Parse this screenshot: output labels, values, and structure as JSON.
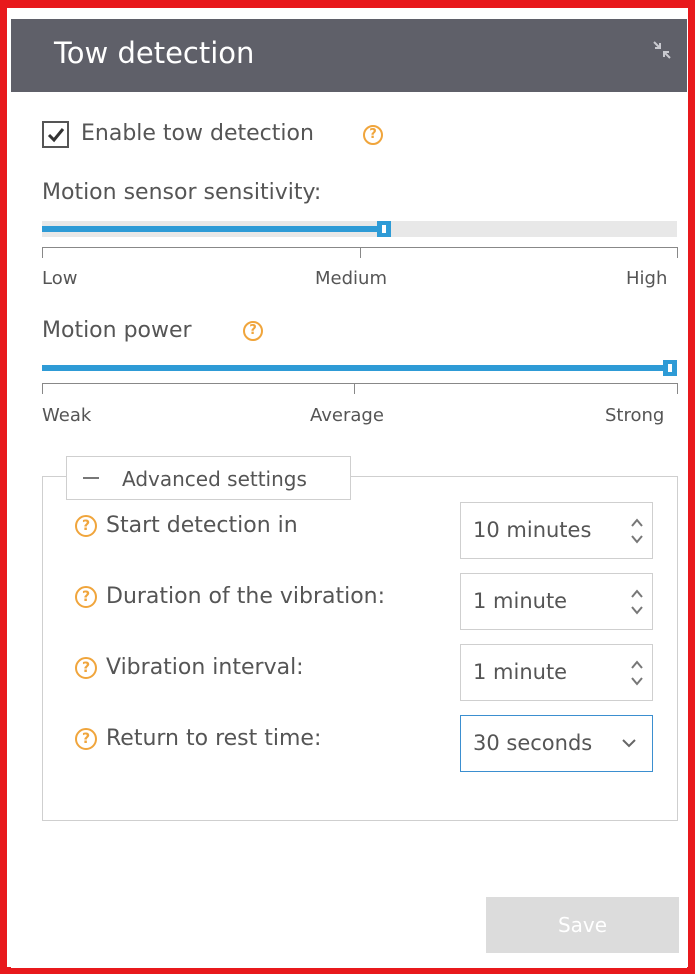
{
  "header": {
    "title": "Tow detection",
    "collapse_icon": "collapse-arrows-icon"
  },
  "enable": {
    "label": "Enable tow detection",
    "checked": true
  },
  "sensitivity": {
    "label": "Motion sensor sensitivity:",
    "value_fraction": 0.54,
    "ticks": [
      "Low",
      "Medium",
      "High"
    ]
  },
  "power": {
    "label": "Motion power",
    "value_fraction": 1.0,
    "ticks": [
      "Weak",
      "Average",
      "Strong"
    ]
  },
  "advanced": {
    "legend": "Advanced settings",
    "rows": [
      {
        "label": "Start detection in",
        "value": "10 minutes",
        "control": "spinner"
      },
      {
        "label": "Duration of the vibration:",
        "value": "1 minute",
        "control": "spinner"
      },
      {
        "label": "Vibration interval:",
        "value": "1 minute",
        "control": "spinner"
      },
      {
        "label": "Return to rest time:",
        "value": "30 seconds",
        "control": "select"
      }
    ]
  },
  "save": {
    "label": "Save",
    "enabled": false
  },
  "colors": {
    "header_bg": "#5f6069",
    "accent": "#2e9bd6",
    "help": "#f0a53c",
    "frame": "#e8191c"
  }
}
